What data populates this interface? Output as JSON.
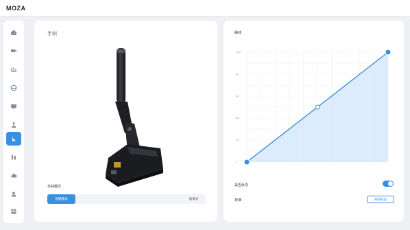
{
  "app": {
    "title": "MOZA"
  },
  "sidebar": {
    "active_index": 7,
    "accent": "#3b8fe0",
    "items": [
      {
        "icon": "home-icon"
      },
      {
        "icon": "steering-base-icon"
      },
      {
        "icon": "pedals-icon"
      },
      {
        "icon": "wheel-icon"
      },
      {
        "icon": "dashboard-icon"
      },
      {
        "icon": "shifter-icon"
      },
      {
        "icon": "handbrake-icon"
      },
      {
        "icon": "sequential-icon"
      },
      {
        "icon": "cloud-icon"
      },
      {
        "icon": "hub-icon"
      },
      {
        "icon": "settings-icon"
      }
    ]
  },
  "handbrake": {
    "title": "手刹",
    "mode_label": "手刹模式",
    "modes": [
      "按键模式",
      "轴模式"
    ],
    "selected_mode": "按键模式"
  },
  "curve": {
    "title": "曲线",
    "y_ticks": [
      "100",
      "80",
      "60",
      "40",
      "20",
      "0"
    ],
    "reverse_label": "是否反向",
    "reverse_enabled": true,
    "calibration_label": "校准",
    "calibration_button": "开始校准"
  },
  "chart_data": {
    "type": "line",
    "x": [
      0,
      50,
      100
    ],
    "y": [
      0,
      50,
      100
    ],
    "ylim": [
      0,
      100
    ],
    "xlim": [
      0,
      100
    ],
    "grid": true
  }
}
